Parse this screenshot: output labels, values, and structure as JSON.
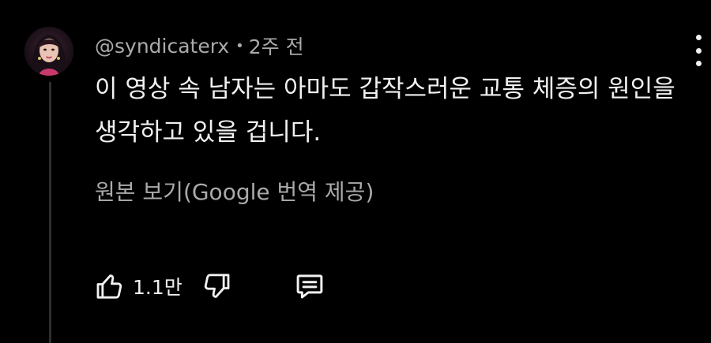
{
  "comment": {
    "author": "@syndicaterx",
    "separator": "•",
    "time": "2주 전",
    "text_lines": [
      "이 영상 속 남자는 아마도 갑작스러운 교통 체증의 원인을",
      "생각하고 있을 겁니다."
    ],
    "translate_link": "원본 보기(Google 번역 제공)",
    "like_count": "1.1만"
  },
  "icons": {
    "menu": "more-vert-icon",
    "like": "thumbs-up-icon",
    "dislike": "thumbs-down-icon",
    "reply": "comment-icon"
  },
  "colors": {
    "background": "#000000",
    "primary_text": "#f1f1f1",
    "secondary_text": "#aaaaaa",
    "thread_line": "#2e2e2e"
  }
}
